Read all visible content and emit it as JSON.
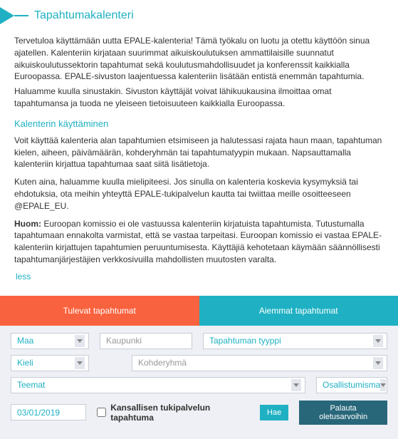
{
  "header": {
    "title": "Tapahtumakalenteri"
  },
  "intro": {
    "p1": "Tervetuloa käyttämään uutta EPALE-kalenteria! Tämä työkalu on luotu ja otettu käyttöön sinua ajatellen. Kalenteriin kirjataan suurimmat aikuiskoulutuksen ammattilaisille suunnatut aikuiskoulutussektorin tapahtumat sekä koulutusmahdollisuudet ja konferenssit kaikkialla Euroopassa. EPALE-sivuston laajentuessa kalenteriin lisätään entistä enemmän tapahtumia.",
    "p2": "Haluamme kuulla sinustakin. Sivuston käyttäjät voivat lähikuukausina ilmoittaa omat tapahtumansa ja tuoda ne yleiseen tietoisuuteen kaikkialla Euroopassa.",
    "usage_header": "Kalenterin käyttäminen",
    "p3": "Voit käyttää kalenteria alan tapahtumien etsimiseen ja halutessasi rajata haun maan, tapahtuman kielen, aiheen, päivämäärän, kohderyhmän tai tapahtumatyypin mukaan. Napsauttamalla kalenteriin kirjattua tapahtumaa saat siitä lisätietoja.",
    "p4": "Kuten aina, haluamme kuulla mielipiteesi. Jos sinulla on kalenteria koskevia kysymyksiä tai ehdotuksia, ota meihin yhteyttä EPALE-tukipalvelun kautta tai twiittaa meille osoitteeseen @EPALE_EU.",
    "note_label": "Huom:",
    "note_text": " Euroopan komissio ei ole vastuussa kalenteriin kirjatuista tapahtumista. Tutustumalla tapahtumaan ennakolta varmistat, että se vastaa tarpeitasi. Euroopan komissio ei vastaa EPALE-kalenteriin kirjattujen tapahtumien peruuntumisesta. Käyttäjiä kehotetaan käymään säännöllisesti tapahtumanjärjestäjien verkkosivuilla mahdollisten muutosten varalta.",
    "less": "less"
  },
  "tabs": {
    "upcoming": "Tulevat tapahtumat",
    "past": "Aiemmat tapahtumat"
  },
  "filters": {
    "country": "Maa",
    "city_placeholder": "Kaupunki",
    "event_type": "Tapahtuman tyyppi",
    "language": "Kieli",
    "target_group": "Kohderyhmä",
    "themes": "Teemat",
    "attendance": "Osallistumisma",
    "date": "03/01/2019",
    "nss_label": "Kansallisen tukipalvelun tapahtuma",
    "search_btn": "Hae",
    "reset_btn": "Palauta oletusarvoihin"
  }
}
